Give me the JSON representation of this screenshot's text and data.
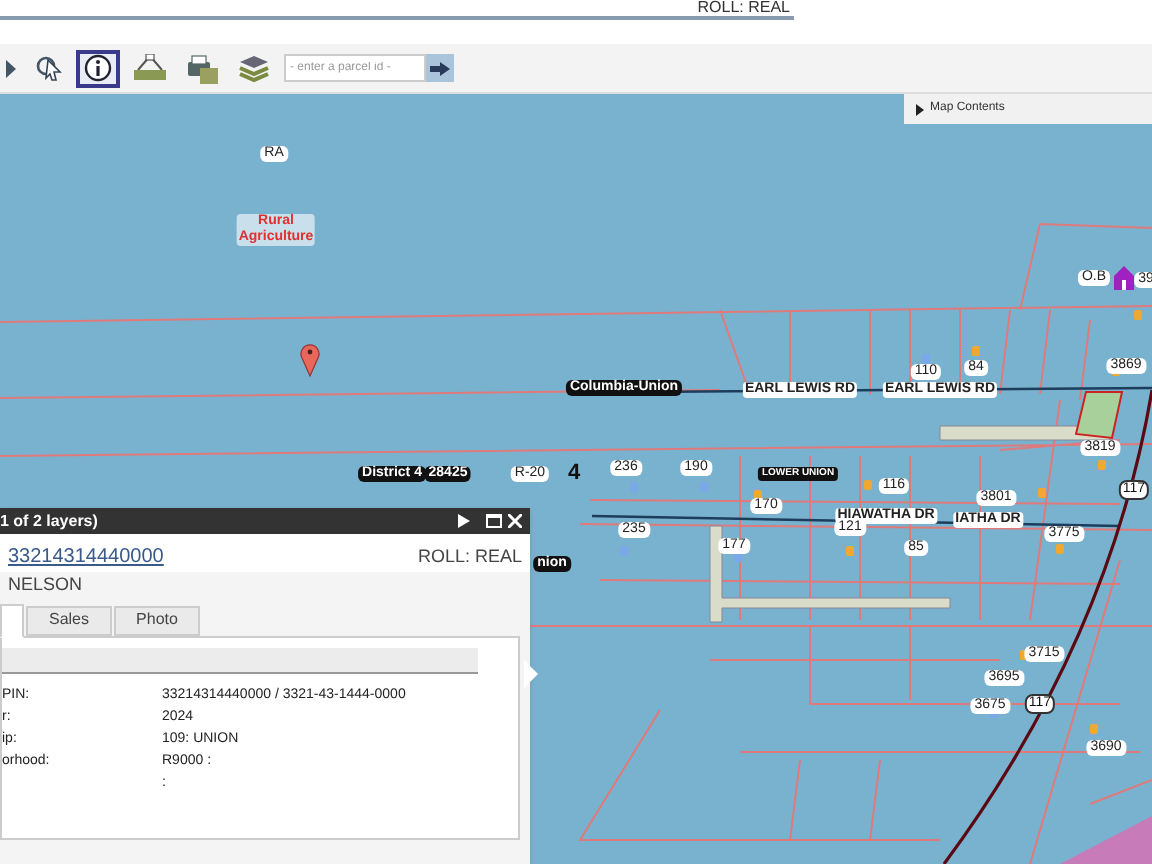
{
  "header": {
    "roll": "ROLL: REAL"
  },
  "toolbar": {
    "tools": [
      {
        "kind": "arrow",
        "selected": false
      },
      {
        "kind": "select",
        "selected": false
      },
      {
        "kind": "info",
        "selected": true
      },
      {
        "kind": "network",
        "selected": false
      },
      {
        "kind": "print",
        "selected": false
      },
      {
        "kind": "layers",
        "selected": false
      }
    ],
    "parcel_search": {
      "placeholder": "- enter a parcel id -"
    }
  },
  "map_contents": {
    "label": "Map Contents",
    "expanded": false
  },
  "map": {
    "labels": [
      {
        "text": "RA",
        "kind": "halo"
      },
      {
        "text": "Rural\nAgriculture",
        "kind": "zone"
      },
      {
        "text": "Columbia-Union",
        "kind": "dark"
      },
      {
        "text": "EARL LEWIS RD",
        "kind": "road"
      },
      {
        "text": "EARL LEWIS RD",
        "kind": "road"
      },
      {
        "text": "110",
        "kind": "halo"
      },
      {
        "text": "84",
        "kind": "halo"
      },
      {
        "text": "3869",
        "kind": "halo"
      },
      {
        "text": "O.B",
        "kind": "halo"
      },
      {
        "text": "39",
        "kind": "halo"
      },
      {
        "text": "District 4",
        "kind": "dark"
      },
      {
        "text": "28425",
        "kind": "dark"
      },
      {
        "text": "R-20",
        "kind": "halo"
      },
      {
        "text": "4",
        "kind": "big"
      },
      {
        "text": "236",
        "kind": "halo"
      },
      {
        "text": "190",
        "kind": "halo"
      },
      {
        "text": "LOWER UNION",
        "kind": "darksmall"
      },
      {
        "text": "116",
        "kind": "halo"
      },
      {
        "text": "170",
        "kind": "halo"
      },
      {
        "text": "3801",
        "kind": "halo"
      },
      {
        "text": "3819",
        "kind": "halo"
      },
      {
        "text": "117",
        "kind": "shield"
      },
      {
        "text": "235",
        "kind": "halo"
      },
      {
        "text": "HIAWATHA DR",
        "kind": "road"
      },
      {
        "text": "IATHA DR",
        "kind": "road"
      },
      {
        "text": "177",
        "kind": "halo"
      },
      {
        "text": "121",
        "kind": "halo"
      },
      {
        "text": "85",
        "kind": "halo"
      },
      {
        "text": "3775",
        "kind": "halo"
      },
      {
        "text": "nion",
        "kind": "dark"
      },
      {
        "text": "3715",
        "kind": "halo"
      },
      {
        "text": "3695",
        "kind": "halo"
      },
      {
        "text": "3675",
        "kind": "halo"
      },
      {
        "text": "117",
        "kind": "shield"
      },
      {
        "text": "3690",
        "kind": "halo"
      }
    ]
  },
  "popup": {
    "title": "1 of 2 layers)",
    "parcel_id": "33214314440000",
    "roll": "ROLL: REAL",
    "owner": "NELSON",
    "tabs": [
      {
        "selected": true
      },
      {
        "label": "Sales",
        "selected": false
      },
      {
        "label": "Photo",
        "selected": false
      }
    ],
    "rows": [
      {
        "label": "PIN:",
        "value": "33214314440000 / 3321-43-1444-0000"
      },
      {
        "label": "r:",
        "value": "2024"
      },
      {
        "label": "ip:",
        "value": "109: UNION"
      },
      {
        "label": "orhood:",
        "value": "R9000 :"
      },
      {
        "value": ":"
      }
    ]
  }
}
